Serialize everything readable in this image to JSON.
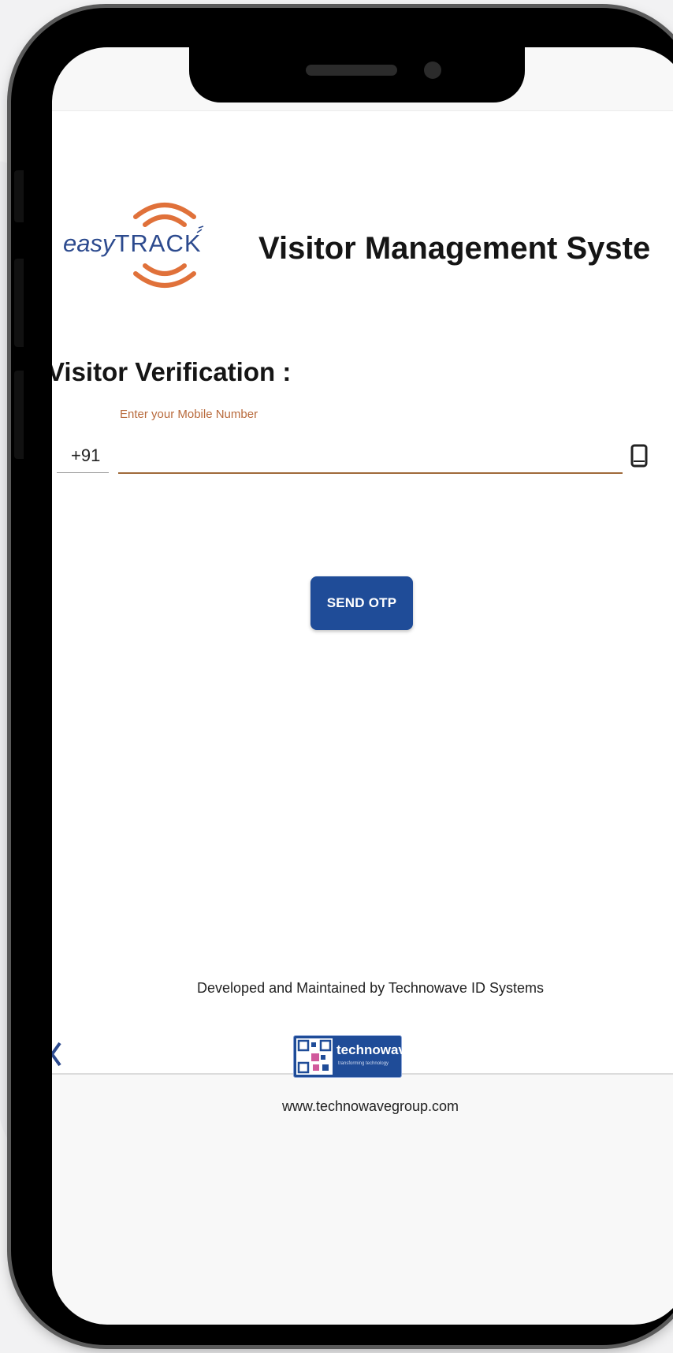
{
  "header": {
    "logo_text_easy": "easy",
    "logo_text_track": "TRACK",
    "title": "Visitor Management Syste"
  },
  "verification": {
    "heading": "Visitor Verification :",
    "country_code": "+91",
    "mobile_label": "Enter your Mobile Number",
    "mobile_value": "",
    "send_button": "SEND OTP"
  },
  "footer": {
    "developer_text": "Developed and Maintained by Technowave ID Systems",
    "company_logo_name": "technowave",
    "company_logo_tagline": "transforming technology",
    "website": "www.technowavegroup.com"
  },
  "colors": {
    "brand_blue": "#1f4c98",
    "logo_orange": "#e0713a",
    "label_orange": "#b86a3c",
    "text_dark": "#151515"
  },
  "icons": [
    "easytrack-logo",
    "mobile-phone-icon",
    "technowave-logo",
    "chevron-left-icon"
  ]
}
